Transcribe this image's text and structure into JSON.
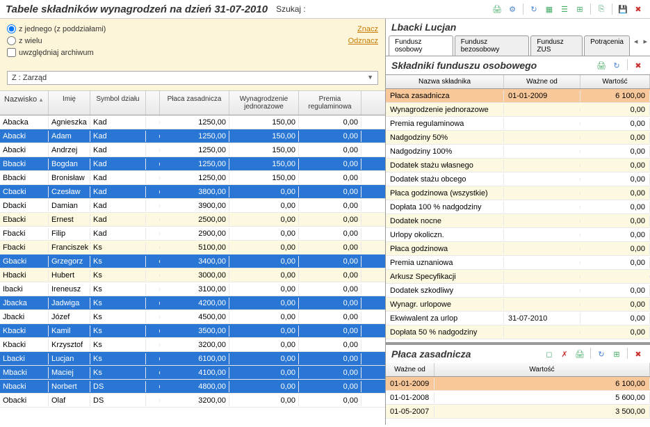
{
  "header": {
    "title": "Tabele składników wynagrodzeń na dzień 31-07-2010",
    "search_label": "Szukaj :"
  },
  "filters": {
    "radio1": "z jednego (z poddziałami)",
    "radio2": "z wielu",
    "checkbox1": "uwzględniaj archiwum",
    "link_mark": "Znacz",
    "link_unmark": "Odznacz",
    "select_value": "Z : Zarząd"
  },
  "grid": {
    "headers": {
      "nazwisko": "Nazwisko",
      "imie": "Imię",
      "symbol": "Symbol działu",
      "placa": "Płaca zasadnicza",
      "wynagr": "Wynagrodzenie jednorazowe",
      "premia": "Premia regulaminowa"
    },
    "rows": [
      {
        "n": "Abacka",
        "i": "Agnieszka",
        "s": "Kad",
        "p": "1250,00",
        "w": "150,00",
        "pr": "0,00",
        "sel": false,
        "alt": false
      },
      {
        "n": "Abacki",
        "i": "Adam",
        "s": "Kad",
        "p": "1250,00",
        "w": "150,00",
        "pr": "0,00",
        "sel": true,
        "alt": false
      },
      {
        "n": "Abacki",
        "i": "Andrzej",
        "s": "Kad",
        "p": "1250,00",
        "w": "150,00",
        "pr": "0,00",
        "sel": false,
        "alt": false
      },
      {
        "n": "Bbacki",
        "i": "Bogdan",
        "s": "Kad",
        "p": "1250,00",
        "w": "150,00",
        "pr": "0,00",
        "sel": true,
        "alt": false
      },
      {
        "n": "Bbacki",
        "i": "Bronisław",
        "s": "Kad",
        "p": "1250,00",
        "w": "150,00",
        "pr": "0,00",
        "sel": false,
        "alt": false
      },
      {
        "n": "Cbacki",
        "i": "Czesław",
        "s": "Kad",
        "p": "3800,00",
        "w": "0,00",
        "pr": "0,00",
        "sel": true,
        "alt": false
      },
      {
        "n": "Dbacki",
        "i": "Damian",
        "s": "Kad",
        "p": "3900,00",
        "w": "0,00",
        "pr": "0,00",
        "sel": false,
        "alt": false
      },
      {
        "n": "Ebacki",
        "i": "Ernest",
        "s": "Kad",
        "p": "2500,00",
        "w": "0,00",
        "pr": "0,00",
        "sel": false,
        "alt": true
      },
      {
        "n": "Fbacki",
        "i": "Filip",
        "s": "Kad",
        "p": "2900,00",
        "w": "0,00",
        "pr": "0,00",
        "sel": false,
        "alt": false
      },
      {
        "n": "Fbacki",
        "i": "Franciszek",
        "s": "Ks",
        "p": "5100,00",
        "w": "0,00",
        "pr": "0,00",
        "sel": false,
        "alt": true
      },
      {
        "n": "Gbacki",
        "i": "Grzegorz",
        "s": "Ks",
        "p": "3400,00",
        "w": "0,00",
        "pr": "0,00",
        "sel": true,
        "alt": false
      },
      {
        "n": "Hbacki",
        "i": "Hubert",
        "s": "Ks",
        "p": "3000,00",
        "w": "0,00",
        "pr": "0,00",
        "sel": false,
        "alt": true
      },
      {
        "n": "Ibacki",
        "i": "Ireneusz",
        "s": "Ks",
        "p": "3100,00",
        "w": "0,00",
        "pr": "0,00",
        "sel": false,
        "alt": false
      },
      {
        "n": "Jbacka",
        "i": "Jadwiga",
        "s": "Ks",
        "p": "4200,00",
        "w": "0,00",
        "pr": "0,00",
        "sel": true,
        "alt": false
      },
      {
        "n": "Jbacki",
        "i": "Józef",
        "s": "Ks",
        "p": "4500,00",
        "w": "0,00",
        "pr": "0,00",
        "sel": false,
        "alt": false
      },
      {
        "n": "Kbacki",
        "i": "Kamil",
        "s": "Ks",
        "p": "3500,00",
        "w": "0,00",
        "pr": "0,00",
        "sel": true,
        "alt": false
      },
      {
        "n": "Kbacki",
        "i": "Krzysztof",
        "s": "Ks",
        "p": "3200,00",
        "w": "0,00",
        "pr": "0,00",
        "sel": false,
        "alt": false
      },
      {
        "n": "Lbacki",
        "i": "Lucjan",
        "s": "Ks",
        "p": "6100,00",
        "w": "0,00",
        "pr": "0,00",
        "sel": true,
        "alt": false
      },
      {
        "n": "Mbacki",
        "i": "Maciej",
        "s": "Ks",
        "p": "4100,00",
        "w": "0,00",
        "pr": "0,00",
        "sel": true,
        "alt": false
      },
      {
        "n": "Nbacki",
        "i": "Norbert",
        "s": "DS",
        "p": "4800,00",
        "w": "0,00",
        "pr": "0,00",
        "sel": true,
        "alt": false
      },
      {
        "n": "Obacki",
        "i": "Olaf",
        "s": "DS",
        "p": "3200,00",
        "w": "0,00",
        "pr": "0,00",
        "sel": false,
        "alt": false
      }
    ]
  },
  "right": {
    "person": "Lbacki Lucjan",
    "tabs": {
      "t1": "Fundusz osobowy",
      "t2": "Fundusz bezosobowy",
      "t3": "Fundusz ZUS",
      "t4": "Potrącenia"
    },
    "section1_title": "Składniki funduszu osobowego",
    "comp_headers": {
      "name": "Nazwa składnika",
      "date": "Ważne od",
      "val": "Wartość"
    },
    "comp_rows": [
      {
        "n": "Płaca zasadnicza",
        "d": "01-01-2009",
        "v": "6 100,00",
        "sel": true
      },
      {
        "n": "Wynagrodzenie jednorazowe",
        "d": "",
        "v": "0,00",
        "alt": true
      },
      {
        "n": "Premia regulaminowa",
        "d": "",
        "v": "0,00"
      },
      {
        "n": "Nadgodziny 50%",
        "d": "",
        "v": "0,00",
        "alt": true
      },
      {
        "n": "Nadgodziny 100%",
        "d": "",
        "v": "0,00"
      },
      {
        "n": "Dodatek stażu własnego",
        "d": "",
        "v": "0,00",
        "alt": true
      },
      {
        "n": "Dodatek stażu obcego",
        "d": "",
        "v": "0,00"
      },
      {
        "n": "Płaca godzinowa (wszystkie)",
        "d": "",
        "v": "0,00",
        "alt": true
      },
      {
        "n": "Dopłata 100 % nadgodziny",
        "d": "",
        "v": "0,00"
      },
      {
        "n": "Dodatek nocne",
        "d": "",
        "v": "0,00",
        "alt": true
      },
      {
        "n": "Urlopy okoliczn.",
        "d": "",
        "v": "0,00"
      },
      {
        "n": "Płaca godzinowa",
        "d": "",
        "v": "0,00",
        "alt": true
      },
      {
        "n": "Premia uznaniowa",
        "d": "",
        "v": "0,00"
      },
      {
        "n": "Arkusz Specyfikacji",
        "d": "",
        "v": "",
        "alt": true
      },
      {
        "n": "Dodatek szkodliwy",
        "d": "",
        "v": "0,00"
      },
      {
        "n": "Wynagr. urlopowe",
        "d": "",
        "v": "0,00",
        "alt": true
      },
      {
        "n": "Ekwiwalent za urlop",
        "d": "31-07-2010",
        "v": "0,00"
      },
      {
        "n": "Dopłata 50 % nadgodziny",
        "d": "",
        "v": "0,00",
        "alt": true
      }
    ],
    "section2_title": "Płaca zasadnicza",
    "detail_headers": {
      "date": "Ważne od",
      "val": "Wartość"
    },
    "detail_rows": [
      {
        "d": "01-01-2009",
        "v": "6 100,00",
        "sel": true
      },
      {
        "d": "01-01-2008",
        "v": "5 600,00"
      },
      {
        "d": "01-05-2007",
        "v": "3 500,00",
        "alt": true
      }
    ]
  }
}
